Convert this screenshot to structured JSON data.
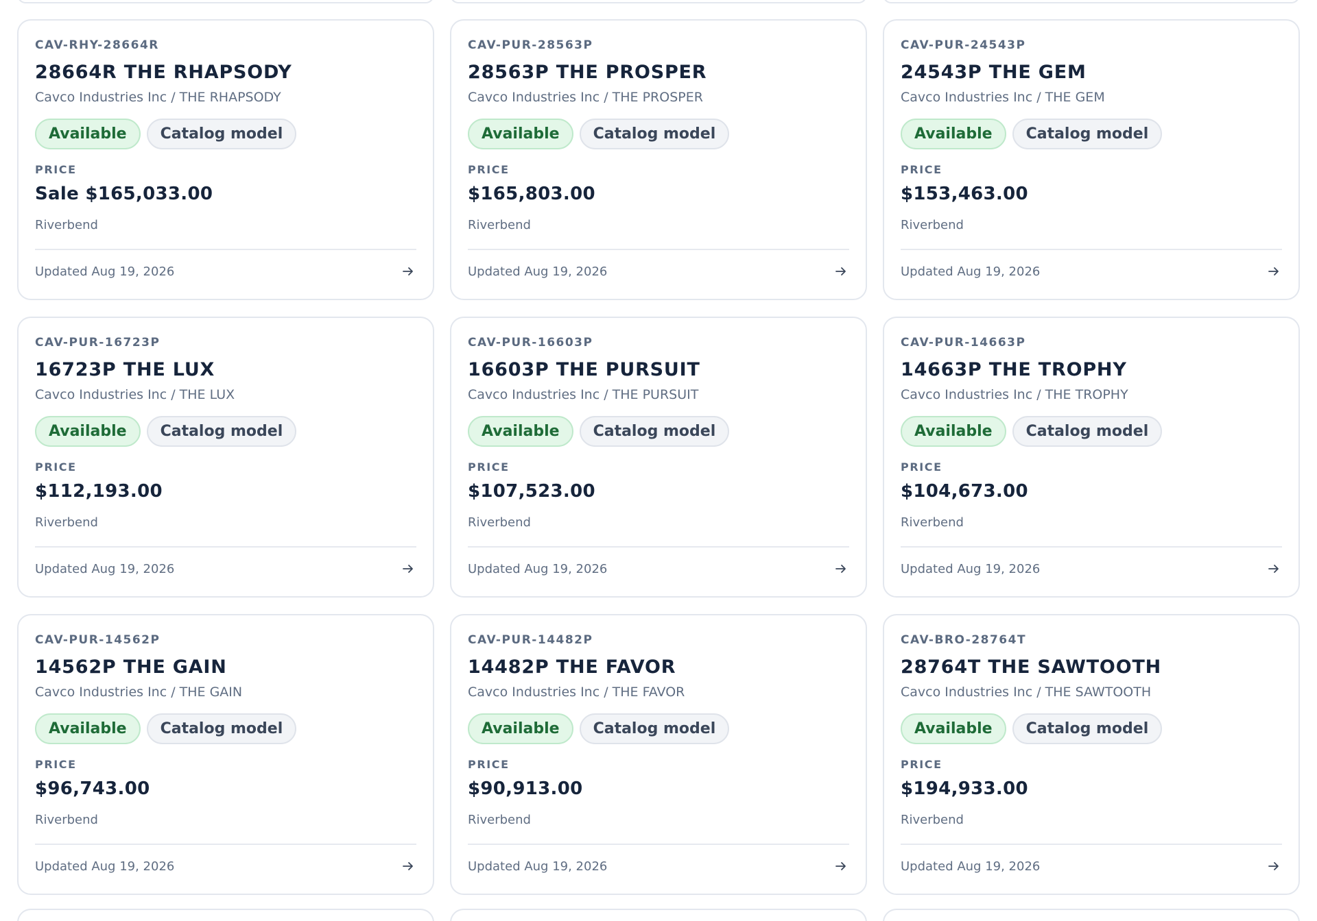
{
  "listings": [
    {
      "sku": "CAV-RHY-28664R",
      "title": "28664R THE RHAPSODY",
      "subtitle": "Cavco Industries Inc / THE RHAPSODY",
      "status": "Available",
      "kind": "Catalog model",
      "price_label": "PRICE",
      "price": "Sale $165,033.00",
      "location": "Riverbend",
      "updated": "Updated Aug 19, 2026",
      "icon": "arrow-right-icon"
    },
    {
      "sku": "CAV-PUR-28563P",
      "title": "28563P THE PROSPER",
      "subtitle": "Cavco Industries Inc / THE PROSPER",
      "status": "Available",
      "kind": "Catalog model",
      "price_label": "PRICE",
      "price": "$165,803.00",
      "location": "Riverbend",
      "updated": "Updated Aug 19, 2026",
      "icon": "arrow-right-icon"
    },
    {
      "sku": "CAV-PUR-24543P",
      "title": "24543P THE GEM",
      "subtitle": "Cavco Industries Inc / THE GEM",
      "status": "Available",
      "kind": "Catalog model",
      "price_label": "PRICE",
      "price": "$153,463.00",
      "location": "Riverbend",
      "updated": "Updated Aug 19, 2026",
      "icon": "arrow-right-icon"
    },
    {
      "sku": "CAV-PUR-16723P",
      "title": "16723P THE LUX",
      "subtitle": "Cavco Industries Inc / THE LUX",
      "status": "Available",
      "kind": "Catalog model",
      "price_label": "PRICE",
      "price": "$112,193.00",
      "location": "Riverbend",
      "updated": "Updated Aug 19, 2026",
      "icon": "arrow-right-icon"
    },
    {
      "sku": "CAV-PUR-16603P",
      "title": "16603P THE PURSUIT",
      "subtitle": "Cavco Industries Inc / THE PURSUIT",
      "status": "Available",
      "kind": "Catalog model",
      "price_label": "PRICE",
      "price": "$107,523.00",
      "location": "Riverbend",
      "updated": "Updated Aug 19, 2026",
      "icon": "arrow-right-icon"
    },
    {
      "sku": "CAV-PUR-14663P",
      "title": "14663P THE TROPHY",
      "subtitle": "Cavco Industries Inc / THE TROPHY",
      "status": "Available",
      "kind": "Catalog model",
      "price_label": "PRICE",
      "price": "$104,673.00",
      "location": "Riverbend",
      "updated": "Updated Aug 19, 2026",
      "icon": "arrow-right-icon"
    },
    {
      "sku": "CAV-PUR-14562P",
      "title": "14562P THE GAIN",
      "subtitle": "Cavco Industries Inc / THE GAIN",
      "status": "Available",
      "kind": "Catalog model",
      "price_label": "PRICE",
      "price": "$96,743.00",
      "location": "Riverbend",
      "updated": "Updated Aug 19, 2026",
      "icon": "arrow-right-icon"
    },
    {
      "sku": "CAV-PUR-14482P",
      "title": "14482P THE FAVOR",
      "subtitle": "Cavco Industries Inc / THE FAVOR",
      "status": "Available",
      "kind": "Catalog model",
      "price_label": "PRICE",
      "price": "$90,913.00",
      "location": "Riverbend",
      "updated": "Updated Aug 19, 2026",
      "icon": "arrow-right-icon"
    },
    {
      "sku": "CAV-BRO-28764T",
      "title": "28764T THE SAWTOOTH",
      "subtitle": "Cavco Industries Inc / THE SAWTOOTH",
      "status": "Available",
      "kind": "Catalog model",
      "price_label": "PRICE",
      "price": "$194,933.00",
      "location": "Riverbend",
      "updated": "Updated Aug 19, 2026",
      "icon": "arrow-right-icon"
    }
  ],
  "colors": {
    "available_bg": "#e3f7e8",
    "available_text": "#1e6b37",
    "catalog_bg": "#f2f4f7",
    "card_border": "#e3e7ee",
    "heading": "#16243b",
    "muted": "#5f6d82"
  }
}
